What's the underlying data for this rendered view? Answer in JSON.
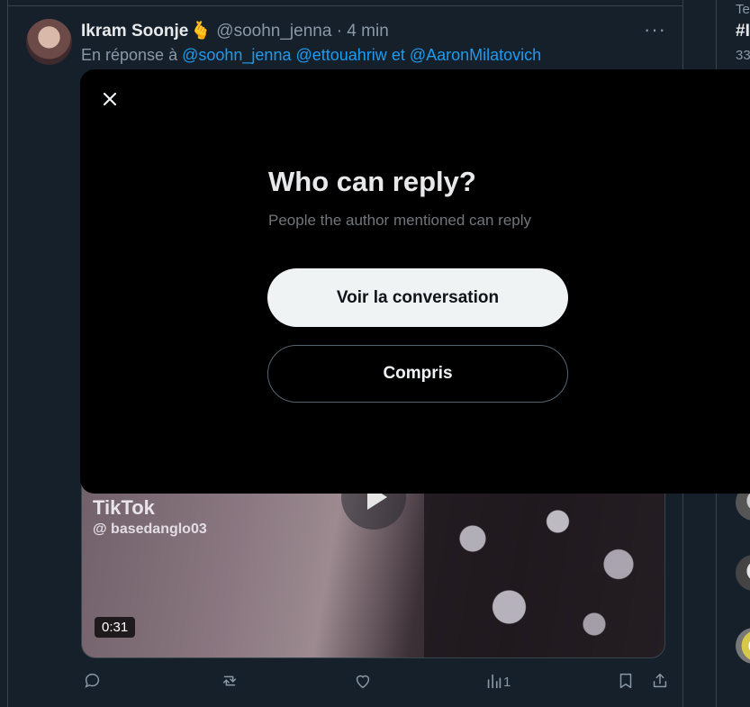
{
  "tweet": {
    "author_name": "Ikram Soonje",
    "author_emoji": "🫰",
    "handle": "@soohn_jenna",
    "separator": "·",
    "time": "4 min",
    "more_icon": "more-icon",
    "reply_prefix": "En réponse à",
    "mentions": [
      "@soohn_jenna",
      "@ettouahriw",
      "@AaronMilatovich"
    ],
    "mention_joiner": "et",
    "media": {
      "watermark_brand": "TikTok",
      "watermark_handle": "@ basedanglo03",
      "duration": "0:31"
    },
    "views_count": "1"
  },
  "right_column": {
    "top_text": "Te",
    "trend": "#I",
    "count": "33"
  },
  "modal": {
    "title": "Who can reply?",
    "subtitle": "People the author mentioned can reply",
    "primary_button": "Voir la conversation",
    "secondary_button": "Compris"
  },
  "colors": {
    "background": "#15202b",
    "modal": "#000000",
    "accent": "#1d9bf0",
    "muted": "#8b98a5"
  }
}
